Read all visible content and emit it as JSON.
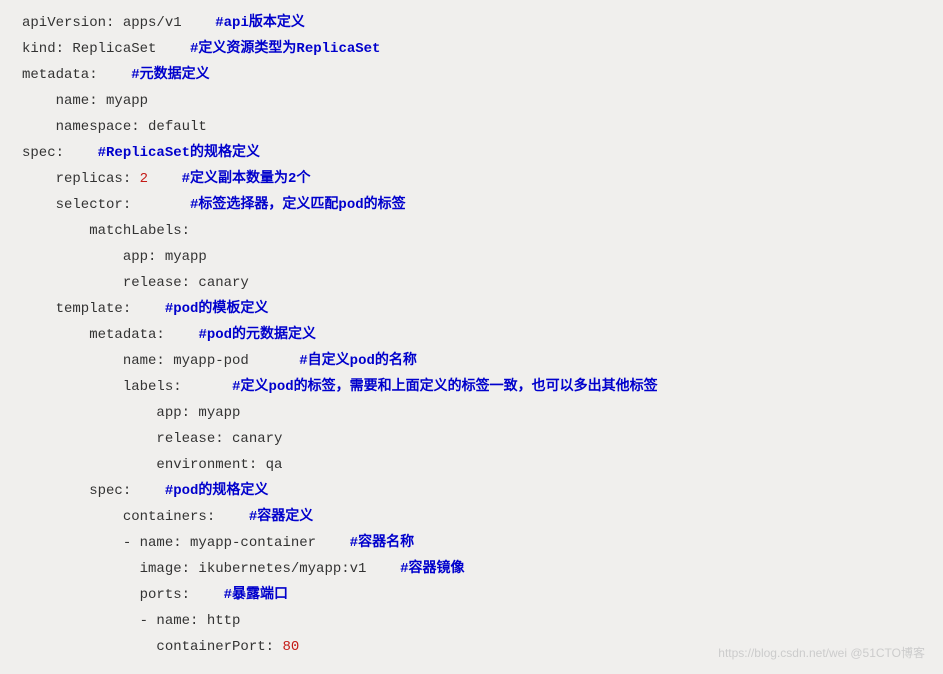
{
  "yaml": {
    "apiVersion": "apiVersion: apps/v1",
    "apiVersion_c": "#api版本定义",
    "kind": "kind: ReplicaSet",
    "kind_c": "#定义资源类型为ReplicaSet",
    "metadata": "metadata:",
    "metadata_c": "#元数据定义",
    "meta_name": "    name: myapp",
    "meta_ns": "    namespace: default",
    "spec": "spec:",
    "spec_c": "#ReplicaSet的规格定义",
    "replicas": "    replicas: ",
    "replicas_n": "2",
    "replicas_c": "#定义副本数量为2个",
    "selector": "    selector:",
    "selector_c": "#标签选择器，定义匹配pod的标签",
    "matchLabels": "        matchLabels:",
    "ml_app": "            app: myapp",
    "ml_release": "            release: canary",
    "template": "    template:",
    "template_c": "#pod的模板定义",
    "t_metadata": "        metadata:",
    "t_metadata_c": "#pod的元数据定义",
    "t_name": "            name: myapp-pod",
    "t_name_c": "#自定义pod的名称",
    "t_labels": "            labels:",
    "t_labels_c": "#定义pod的标签，需要和上面定义的标签一致，也可以多出其他标签",
    "tl_app": "                app: myapp",
    "tl_release": "                release: canary",
    "tl_env": "                environment: qa",
    "t_spec": "        spec:",
    "t_spec_c": "#pod的规格定义",
    "containers": "            containers:",
    "containers_c": "#容器定义",
    "c_name": "            - name: myapp-container",
    "c_name_c": "#容器名称",
    "c_image": "              image: ikubernetes/myapp:v1",
    "c_image_c": "#容器镜像",
    "c_ports": "              ports:",
    "c_ports_c": "#暴露端口",
    "p_name": "              - name: http",
    "p_cport": "                containerPort: ",
    "p_cport_n": "80"
  },
  "watermark": "https://blog.csdn.net/wei  @51CTO博客"
}
